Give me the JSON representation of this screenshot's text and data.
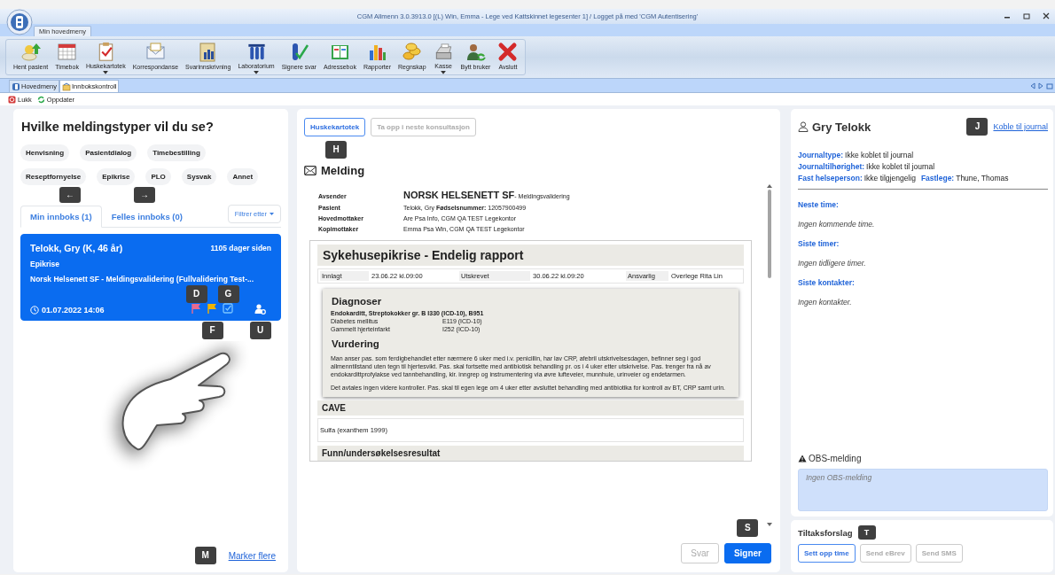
{
  "window": {
    "title": "CGM Allmenn 3.0.3913.0 [(L) Win, Emma - Lege ved Kattskinnet legesenter 1] / Logget på med 'CGM Autentisering'"
  },
  "ribbon": {
    "tab": "Min hovedmeny",
    "items": [
      {
        "label": "Hent pasient",
        "dropdown": false
      },
      {
        "label": "Timebok",
        "dropdown": false
      },
      {
        "label": "Huskekartotek",
        "dropdown": true
      },
      {
        "label": "Korrespondanse",
        "dropdown": false
      },
      {
        "label": "Svarinnskrivning",
        "dropdown": false
      },
      {
        "label": "Laboratorium",
        "dropdown": true
      },
      {
        "label": "Signere svar",
        "dropdown": false
      },
      {
        "label": "Adressebok",
        "dropdown": false
      },
      {
        "label": "Rapporter",
        "dropdown": false
      },
      {
        "label": "Regnskap",
        "dropdown": false
      },
      {
        "label": "Kasse",
        "dropdown": true
      },
      {
        "label": "Bytt bruker",
        "dropdown": false
      },
      {
        "label": "Avslutt",
        "dropdown": false
      }
    ]
  },
  "doc_tabs": [
    {
      "label": "Hovedmeny",
      "selected": false
    },
    {
      "label": "Innbokskontroll",
      "selected": true
    }
  ],
  "toolbar": [
    "Lukk",
    "Oppdater"
  ],
  "filter_panel": {
    "title": "Hvilke meldingstyper vil du se?",
    "chip_rows": [
      [
        "Henvisning",
        "Pasientdialog",
        "Timebestilling"
      ],
      [
        "Reseptfornyelse",
        "Epikrise",
        "PLO",
        "Sysvak",
        "Annet"
      ]
    ],
    "hints": [
      "←",
      "→"
    ],
    "inbox_tabs": [
      {
        "label": "Min innboks (1)",
        "selected": true
      },
      {
        "label": "Felles innboks (0)",
        "selected": false
      }
    ],
    "filter_button": "Filtrer etter",
    "messages": [
      {
        "patient": "Telokk, Gry (K, 46 år)",
        "age": "1105 dager siden",
        "type": "Epikrise",
        "sender": "Norsk Helsenett SF - Meldingsvalidering (Fullvalidering Test-...",
        "time": "01.07.2022 14:06",
        "selected": true,
        "hints": [
          "D",
          "F",
          "G",
          "U"
        ]
      }
    ],
    "mark_more": {
      "label": "Marker flere",
      "hint": "M"
    }
  },
  "message_panel": {
    "actions": [
      {
        "label": "Huskekartotek",
        "disabled": false,
        "hint": "H"
      },
      {
        "label": "Ta opp i neste konsultasjon",
        "disabled": true
      }
    ],
    "title": "Melding",
    "header": [
      {
        "label": "Avsender",
        "value": "**NORSK HELSENETT SF**- Meldingsvalidering",
        "kind": "sender"
      },
      {
        "label": "Pasient",
        "value": "Telokk, Gry  **Fødselsnummer:** 12057900499",
        "kind": "plain"
      },
      {
        "label": "Hovedmottaker",
        "value": "Are Psa Info, CGM QA TEST Legekontor",
        "kind": "plain"
      },
      {
        "label": "Kopimottaker",
        "value": "Emma Psa Win, CGM QA TEST Legekontor",
        "kind": "plain"
      }
    ],
    "document": {
      "title": "Sykehusepikrise - Endelig rapport",
      "info": [
        {
          "label": "Innlagt",
          "value": "23.06.22 kl.09:00"
        },
        {
          "label": "Utskrevet",
          "value": "30.06.22 kl.09:20"
        },
        {
          "label": "Ansvarlig",
          "value": "Overlege Rita Lin"
        }
      ],
      "diagnoses_title": "Diagnoser",
      "main_diagnosis": "Endokarditt, Streptokokker gr. B I330  (ICD-10), B951",
      "diagnoses": [
        {
          "name": "Diabetes mellitus",
          "code": "E119  (ICD-10)"
        },
        {
          "name": "Gammelt hjerteinfarkt",
          "code": "I252  (ICD-10)"
        }
      ],
      "assessment_title": "Vurdering",
      "paragraphs": [
        "Man anser pas. som ferdigbehandlet etter nærmere 6 uker med i.v. penicillin, har lav CRP, afebril utskrivelsesdagen, befinner seg i god allmenntilstand uten tegn til hjertesvikt. Pas. skal fortsette med antibiotisk behandling pr. os i 4 uker etter utskrivelse. Pas. trenger fra nå av endokardittprofylakse ved tannbehandling, kir. inngrep og instrumentering via øvre lufteveier, munnhule, urinveier og endetarmen.",
        "Det avtales ingen videre kontroller. Pas. skal til egen lege om 4 uker etter avsluttet behandling med antibiotika for kontroll av BT, CRP samt urin."
      ],
      "sections": [
        {
          "title": "CAVE",
          "body": "Sulfa (exanthem 1999)"
        },
        {
          "title": "Funn/undersøkelsesresultat"
        }
      ]
    },
    "footer": [
      {
        "label": "Svar",
        "kind": "secondary",
        "disabled": true
      },
      {
        "label": "Signer",
        "kind": "primary",
        "disabled": false,
        "hint": "S"
      }
    ]
  },
  "patient_panel": {
    "name": "Gry Telokk",
    "link": "Koble til journal",
    "link_hint": "J",
    "field_rows": [
      [
        {
          "label": "Journaltype:",
          "value": "Ikke koblet til journal"
        }
      ],
      [
        {
          "label": "Journaltilhørighet:",
          "value": "Ikke koblet til journal"
        }
      ],
      [
        {
          "label": "Fast helseperson:",
          "value": "Ikke tilgjengelig"
        },
        {
          "label": "Fastlege:",
          "value": "Thune, Thomas"
        }
      ]
    ],
    "sections": [
      {
        "title": "Neste time:",
        "text": "Ingen kommende time."
      },
      {
        "title": "Siste timer:",
        "text": "Ingen tidligere timer."
      },
      {
        "title": "Siste kontakter:",
        "text": "Ingen kontakter."
      }
    ],
    "obs": {
      "title": "OBS-melding",
      "placeholder": "Ingen OBS-melding"
    },
    "suggestions": {
      "title": "Tiltaksforslag",
      "hint": "T",
      "buttons": [
        {
          "label": "Sett opp time",
          "disabled": false
        },
        {
          "label": "Send eBrev",
          "disabled": true
        },
        {
          "label": "Send SMS",
          "disabled": true
        }
      ]
    }
  }
}
